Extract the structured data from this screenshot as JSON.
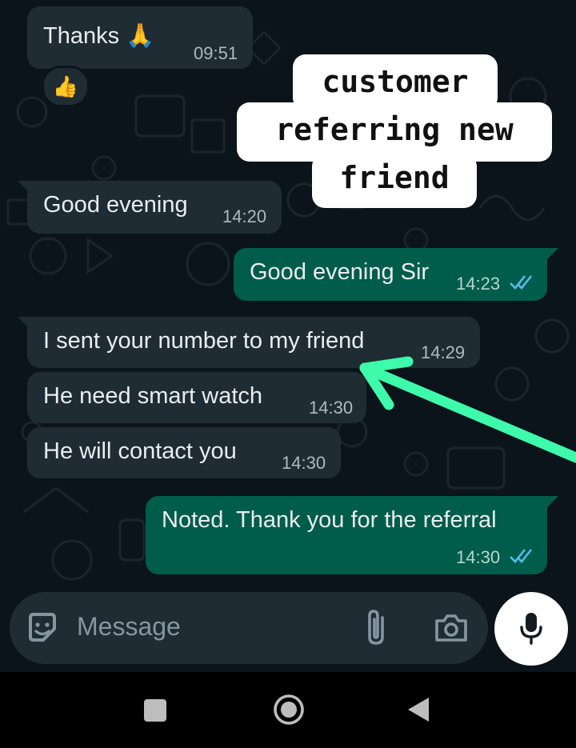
{
  "messages": [
    {
      "side": "in",
      "text": "Thanks 🙏",
      "time": "09:51",
      "reaction": "👍"
    },
    {
      "side": "in",
      "text": "Good evening",
      "time": "14:20"
    },
    {
      "side": "out",
      "text": "Good evening Sir",
      "time": "14:23",
      "status": "read"
    },
    {
      "side": "in",
      "text": "I sent your number to my friend",
      "time": "14:29"
    },
    {
      "side": "in",
      "text": "He need smart watch",
      "time": "14:30"
    },
    {
      "side": "in",
      "text": "He will contact you",
      "time": "14:30"
    },
    {
      "side": "out",
      "text": "Noted. Thank you for the referral",
      "time": "14:30",
      "status": "read"
    }
  ],
  "annotation": {
    "lines": [
      "customer",
      "referring new",
      "friend"
    ],
    "arrow_color": "#3dfbaa"
  },
  "composer": {
    "placeholder": "Message",
    "icons": [
      "sticker-icon",
      "attach-icon",
      "camera-icon",
      "mic-icon"
    ]
  },
  "navigation": {
    "icons": [
      "recents-square-icon",
      "home-circle-icon",
      "back-triangle-icon"
    ]
  },
  "colors": {
    "chat_bg": "#0b141a",
    "incoming_bubble": "#1f2c34",
    "outgoing_bubble": "#005c4b",
    "read_ticks": "#53bdeb"
  }
}
